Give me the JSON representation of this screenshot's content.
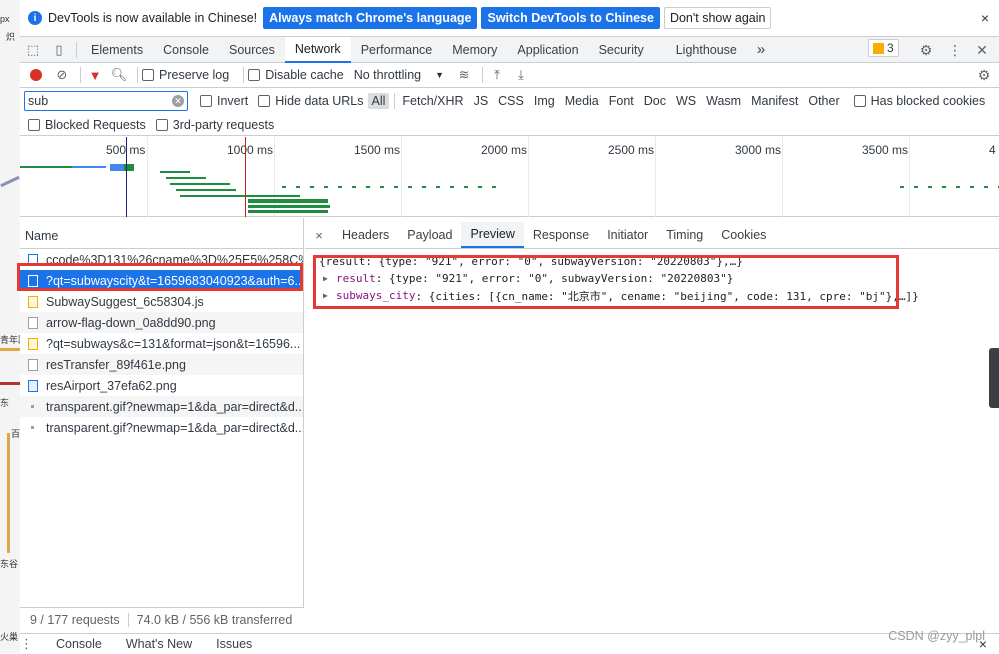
{
  "background_page": {
    "fragments": [
      "px",
      "炽",
      "青年路",
      "东",
      "百",
      "东谷",
      "火巢"
    ]
  },
  "infobar": {
    "message": "DevTools is now available in Chinese!",
    "btn_match": "Always match Chrome's language",
    "btn_switch": "Switch DevTools to Chinese",
    "btn_dismiss": "Don't show again",
    "close": "×"
  },
  "tabs": [
    "Elements",
    "Console",
    "Sources",
    "Network",
    "Performance",
    "Memory",
    "Application",
    "Security",
    "Lighthouse"
  ],
  "active_tab": "Network",
  "more_tabs": "»",
  "issues_count": "3",
  "toolbar": {
    "preserve_log": "Preserve log",
    "disable_cache": "Disable cache",
    "throttling": "No throttling"
  },
  "filter": {
    "value": "sub",
    "invert": "Invert",
    "hide_data_urls": "Hide data URLs",
    "types": [
      "All",
      "Fetch/XHR",
      "JS",
      "CSS",
      "Img",
      "Media",
      "Font",
      "Doc",
      "WS",
      "Wasm",
      "Manifest",
      "Other"
    ],
    "has_blocked_cookies": "Has blocked cookies",
    "blocked_requests": "Blocked Requests",
    "third_party": "3rd-party requests"
  },
  "overview": {
    "ticks": [
      "500 ms",
      "1000 ms",
      "1500 ms",
      "2000 ms",
      "2500 ms",
      "3000 ms",
      "3500 ms",
      "4"
    ]
  },
  "name_pane": {
    "header": "Name",
    "requests": [
      {
        "name": "ccode%3D131%26cname%3D%25E5%258C%...",
        "type": "doc"
      },
      {
        "name": "?qt=subwayscity&t=1659683040923&auth=6...",
        "type": "sel"
      },
      {
        "name": "SubwaySuggest_6c58304.js",
        "type": "script"
      },
      {
        "name": "arrow-flag-down_0a8dd90.png",
        "type": "plain"
      },
      {
        "name": "?qt=subways&c=131&format=json&t=16596...",
        "type": "script"
      },
      {
        "name": "resTransfer_89f461e.png",
        "type": "plain"
      },
      {
        "name": "resAirport_37efa62.png",
        "type": "img"
      },
      {
        "name": "transparent.gif?newmap=1&da_par=direct&d...",
        "type": "gif"
      },
      {
        "name": "transparent.gif?newmap=1&da_par=direct&d...",
        "type": "gif"
      }
    ],
    "status_requests": "9 / 177 requests",
    "status_transferred": "74.0 kB / 556 kB transferred"
  },
  "detail": {
    "close": "×",
    "tabs": [
      "Headers",
      "Payload",
      "Preview",
      "Response",
      "Initiator",
      "Timing",
      "Cookies"
    ],
    "active_tab": "Preview",
    "lines": {
      "l1": "{result: {type: \"921\", error: \"0\", subwayVersion: \"20220803\"},…}",
      "l2_key": "result",
      "l2_val": ": {type: \"921\", error: \"0\", subwayVersion: \"20220803\"}",
      "l3_key": "subways_city",
      "l3_val": ": {cities: [{cn_name: \"北京市\", cename: \"beijing\", code: 131, cpre: \"bj\"},…]}"
    }
  },
  "drawer": {
    "tabs": [
      "Console",
      "What's New",
      "Issues"
    ],
    "close": "×"
  },
  "watermark": "CSDN @zyy_plpl",
  "colors": {
    "accent": "#1a73e8",
    "highlight": "#e53935",
    "record": "#d93025"
  }
}
